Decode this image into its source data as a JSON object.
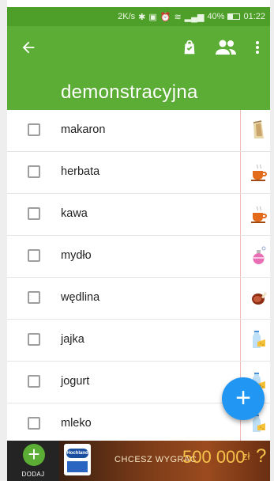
{
  "status_bar": {
    "net_speed": "2K/s",
    "signal": "▂▄▆",
    "battery_percent": "40%",
    "battery_level": 0.4,
    "time": "01:22"
  },
  "toolbar": {
    "title": "demonstracyjna",
    "back_icon": "arrow-left-icon",
    "shop_icon": "shopping-bag-icon",
    "share_icon": "people-icon",
    "menu_icon": "more-vert-icon"
  },
  "items": [
    {
      "name": "makaron",
      "category_icon": "pasta-bag-icon"
    },
    {
      "name": "herbata",
      "category_icon": "tea-cup-icon"
    },
    {
      "name": "kawa",
      "category_icon": "coffee-cup-icon"
    },
    {
      "name": "mydło",
      "category_icon": "soap-bottle-icon"
    },
    {
      "name": "wędlina",
      "category_icon": "ham-icon"
    },
    {
      "name": "jajka",
      "category_icon": "milk-cheese-icon"
    },
    {
      "name": "jogurt",
      "category_icon": "milk-cheese-icon"
    },
    {
      "name": "mleko",
      "category_icon": "milk-cheese-icon"
    }
  ],
  "fab": {
    "label": "+"
  },
  "bottom_bar": {
    "add_label": "DODAJ",
    "add_symbol": "+",
    "ad": {
      "brand": "Hochland",
      "text": "CHCESZ WYGRAĆ",
      "amount": "500 000",
      "suffix": "zł",
      "question": "?"
    }
  },
  "colors": {
    "primary": "#5bad35",
    "status": "#4e9f2a",
    "fab": "#2196f3"
  }
}
